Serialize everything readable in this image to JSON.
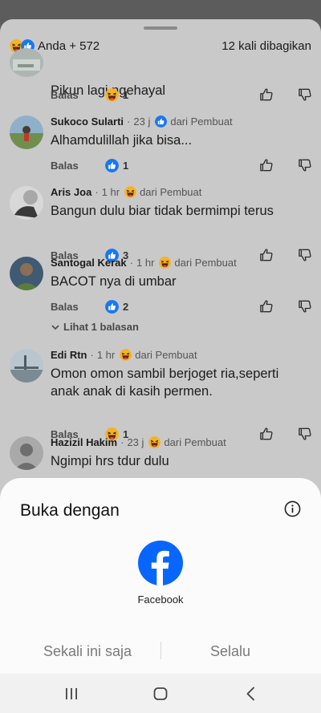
{
  "header": {
    "reactions_label": "Anda + 572",
    "shares_label": "12 kali dibagikan"
  },
  "comments": [
    {
      "name": "",
      "time": "",
      "badge": "",
      "text": "Pikun lagi ngehayal",
      "reply": "Balas",
      "reaction": "haha",
      "count": "1"
    },
    {
      "name": "Sukoco Sularti",
      "time": "23 j",
      "badge_icon": "like",
      "badge": "dari Pembuat",
      "text": "Alhamdulillah jika bisa...",
      "reply": "Balas",
      "reaction": "like",
      "count": "1"
    },
    {
      "name": "Aris Joa",
      "time": "1 hr",
      "badge_icon": "haha",
      "badge": "dari Pembuat",
      "text": "Bangun dulu biar tidak bermimpi terus",
      "reply": "Balas",
      "reaction": "like",
      "count": "3"
    },
    {
      "name": "Santogal Kerak",
      "time": "1 hr",
      "badge_icon": "haha",
      "badge": "dari Pembuat",
      "text": "BACOT nya di umbar",
      "reply": "Balas",
      "reaction": "like",
      "count": "2",
      "see_replies": "Lihat 1 balasan"
    },
    {
      "name": "Edi Rtn",
      "time": "1 hr",
      "badge_icon": "haha",
      "badge": "dari Pembuat",
      "text": "Omon omon sambil berjoget ria,seperti anak anak di kasih permen.",
      "reply": "Balas",
      "reaction": "haha",
      "count": "1"
    },
    {
      "name": "Hazizil Hakim",
      "time": "23 j",
      "badge_icon": "haha",
      "badge": "dari Pembuat",
      "text": "Ngimpi hrs tdur dulu"
    }
  ],
  "dialog": {
    "title": "Buka dengan",
    "app_label": "Facebook",
    "once_label": "Sekali ini saja",
    "always_label": "Selalu"
  },
  "colors": {
    "facebook_blue": "#0866ff",
    "haha_yellow": "#f7b125",
    "sheet_dimmed": "#c9c9c9"
  },
  "icons": [
    "haha-emoji-icon",
    "like-reaction-icon",
    "upvote-icon",
    "downvote-icon",
    "info-icon",
    "facebook-logo-icon",
    "recents-icon",
    "home-icon",
    "back-icon"
  ]
}
